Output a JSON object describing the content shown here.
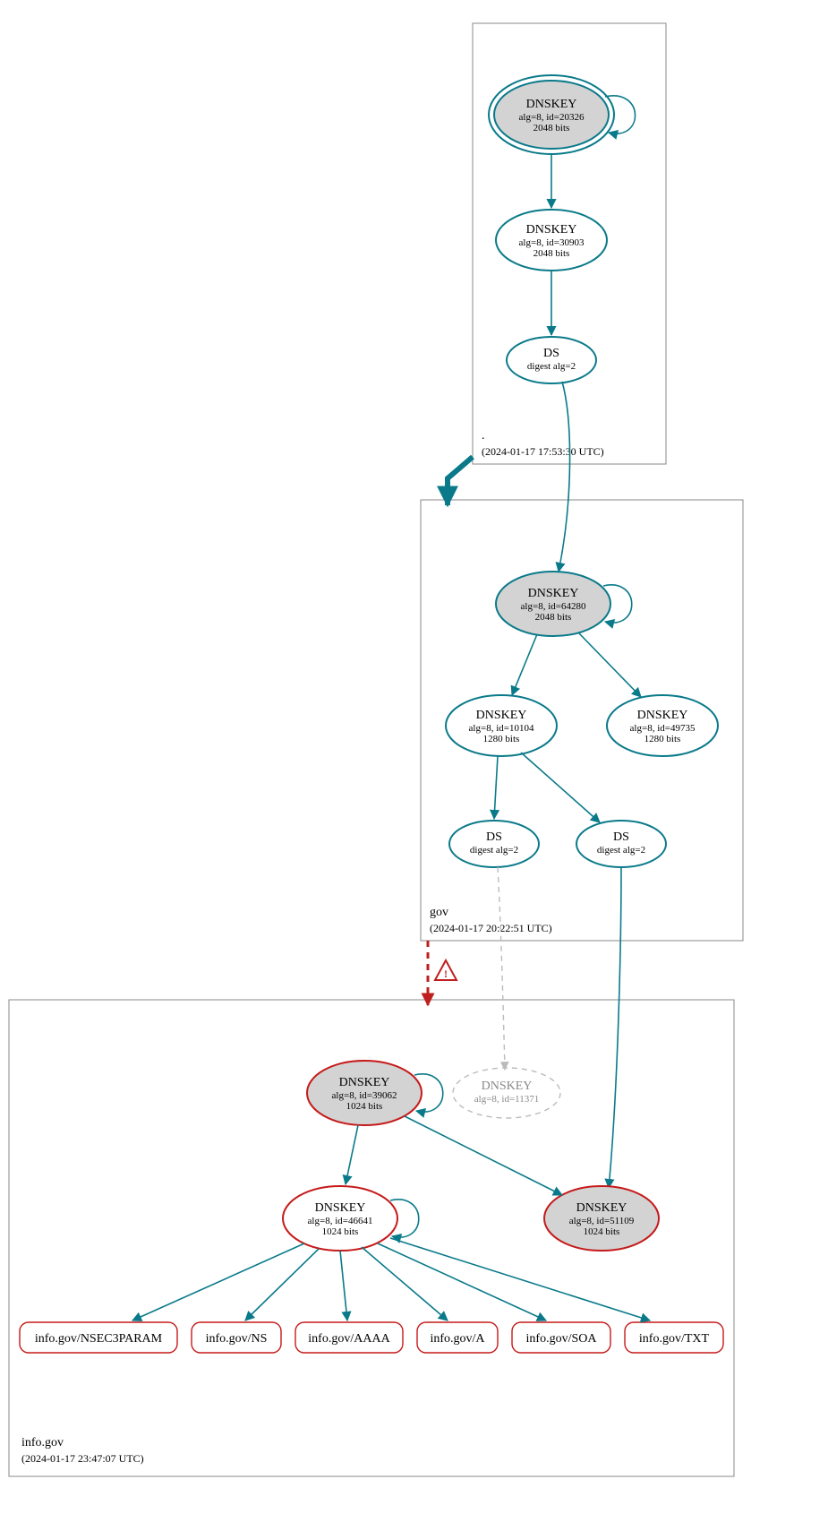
{
  "diagram_type": "DNSSEC delegation/authentication graph",
  "colors": {
    "teal": "#0a7a8a",
    "red": "#c61a1a",
    "grey_stroke": "#bbbbbb",
    "grey_fill": "#d3d3d3"
  },
  "zones": {
    "root": {
      "label": ".",
      "timestamp": "(2024-01-17 17:53:30 UTC)",
      "nodes": {
        "ksk": {
          "title": "DNSKEY",
          "line2": "alg=8, id=20326",
          "line3": "2048 bits",
          "style": "double-ellipse teal grey-fill self-loop"
        },
        "zsk": {
          "title": "DNSKEY",
          "line2": "alg=8, id=30903",
          "line3": "2048 bits",
          "style": "ellipse teal white-fill"
        },
        "ds": {
          "title": "DS",
          "line2": "digest alg=2",
          "style": "ellipse teal white-fill"
        }
      }
    },
    "gov": {
      "label": "gov",
      "timestamp": "(2024-01-17 20:22:51 UTC)",
      "nodes": {
        "ksk": {
          "title": "DNSKEY",
          "line2": "alg=8, id=64280",
          "line3": "2048 bits",
          "style": "ellipse teal grey-fill self-loop"
        },
        "zsk1": {
          "title": "DNSKEY",
          "line2": "alg=8, id=10104",
          "line3": "1280 bits",
          "style": "ellipse teal white-fill"
        },
        "zsk2": {
          "title": "DNSKEY",
          "line2": "alg=8, id=49735",
          "line3": "1280 bits",
          "style": "ellipse teal white-fill"
        },
        "ds1": {
          "title": "DS",
          "line2": "digest alg=2",
          "style": "ellipse teal white-fill"
        },
        "ds2": {
          "title": "DS",
          "line2": "digest alg=2",
          "style": "ellipse teal white-fill"
        }
      }
    },
    "infogov": {
      "label": "info.gov",
      "timestamp": "(2024-01-17 23:47:07 UTC)",
      "nodes": {
        "ksk": {
          "title": "DNSKEY",
          "line2": "alg=8, id=39062",
          "line3": "1024 bits",
          "style": "ellipse red grey-fill self-loop"
        },
        "ghost": {
          "title": "DNSKEY",
          "line2": "alg=8, id=11371",
          "style": "ellipse grey dashed no-fill"
        },
        "zsk": {
          "title": "DNSKEY",
          "line2": "alg=8, id=46641",
          "line3": "1024 bits",
          "style": "ellipse red white-fill self-loop"
        },
        "ksk2": {
          "title": "DNSKEY",
          "line2": "alg=8, id=51109",
          "line3": "1024 bits",
          "style": "ellipse red grey-fill"
        }
      },
      "rrsets": {
        "r1": "info.gov/NSEC3PARAM",
        "r2": "info.gov/NS",
        "r3": "info.gov/AAAA",
        "r4": "info.gov/A",
        "r5": "info.gov/SOA",
        "r6": "info.gov/TXT"
      }
    }
  },
  "warning_icon_edge": "gov -> info.gov delegation (red dashed, warning)"
}
